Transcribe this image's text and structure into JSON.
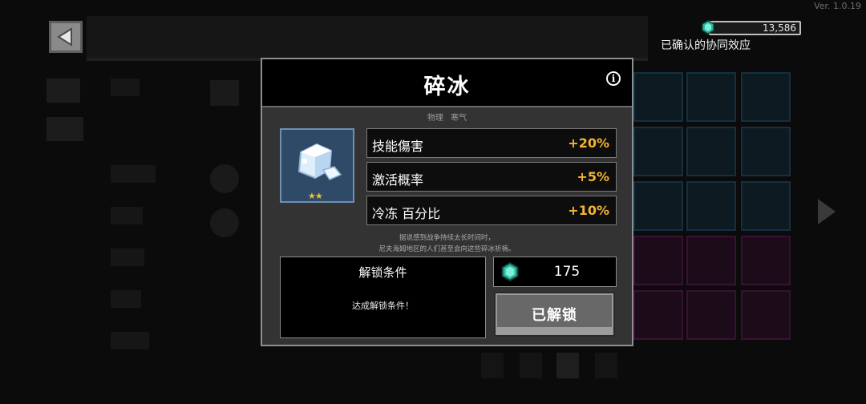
{
  "hud": {
    "version": "Ver. 1.0.19",
    "currency_value": "13,586",
    "synergy_label": "已确认的协同效应"
  },
  "modal": {
    "title": "碎冰",
    "tags": [
      "物理",
      "寒气"
    ],
    "stars": "★★",
    "stats": [
      {
        "name": "技能傷害",
        "value": "+20%"
      },
      {
        "name": "激活概率",
        "value": "+5%"
      },
      {
        "name": "冷冻 百分比",
        "value": "+10%"
      }
    ],
    "description": [
      "据说感到战争持续太长时间时，",
      "尼夫海姆地区的人们甚至会向这些碎冰祈祷。"
    ],
    "unlock_title": "解锁条件",
    "unlock_condition": "达成解锁条件！",
    "price": "175",
    "unlocked_button": "已解锁"
  },
  "colors": {
    "stat_value": "#f5b432",
    "item_bg": "#2e4a66",
    "modal_bg": "#333333"
  }
}
